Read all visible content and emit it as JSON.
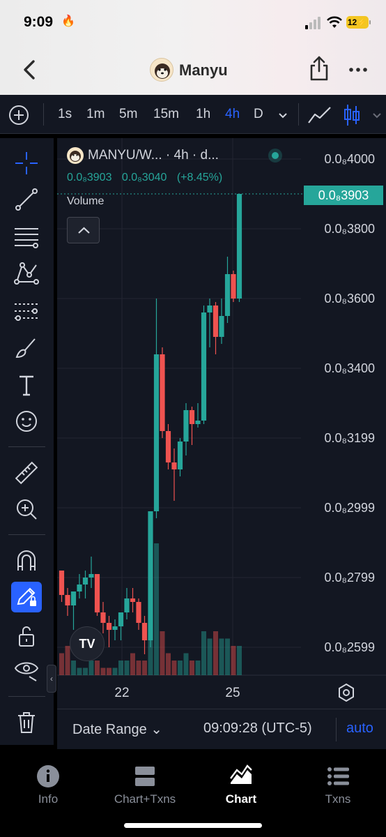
{
  "status_bar": {
    "time": "9:09",
    "battery": "12"
  },
  "header": {
    "title": "Manyu",
    "back_icon": "chevron-left-icon",
    "share_icon": "share-icon",
    "more_icon": "more-icon"
  },
  "toolbar": {
    "intervals": [
      "1s",
      "1m",
      "5m",
      "15m",
      "1h",
      "4h",
      "D"
    ],
    "active_interval": "4h"
  },
  "legend": {
    "symbol": "MANYU/W... · 4h · d...",
    "ohlc": [
      "0.0₈3903",
      "0.0₈3040",
      "(+8.45%)"
    ],
    "volume_label": "Volume"
  },
  "price_axis": {
    "labels": [
      "0.0₈4000",
      "0.0₈3800",
      "0.0₈3600",
      "0.0₈3400",
      "0.0₈3199",
      "0.0₈2999",
      "0.0₈2799",
      "0.0₈2599"
    ],
    "current_price_tag": "0.0₈3903"
  },
  "time_axis": {
    "labels": [
      "22",
      "25"
    ]
  },
  "chart_footer": {
    "date_range": "Date Range",
    "clock": "09:09:28 (UTC-5)",
    "auto": "auto"
  },
  "tabs": [
    {
      "label": "Info",
      "icon": "info-icon"
    },
    {
      "label": "Chart+Txns",
      "icon": "split-view-icon"
    },
    {
      "label": "Chart",
      "icon": "chart-icon"
    },
    {
      "label": "Txns",
      "icon": "list-icon"
    }
  ],
  "active_tab": "Chart",
  "colors": {
    "up": "#26a69a",
    "down": "#ef5350",
    "accent": "#2962ff",
    "background": "#131722"
  },
  "chart_data": {
    "type": "candlestick",
    "title": "",
    "y_unit": "× 1e-8",
    "ylim": [
      25.2,
      40.6
    ],
    "candles": [
      {
        "o": 28.2,
        "h": 28.2,
        "l": 27.3,
        "c": 27.5
      },
      {
        "o": 27.5,
        "h": 27.7,
        "l": 26.9,
        "c": 27.2
      },
      {
        "o": 27.2,
        "h": 27.6,
        "l": 26.5,
        "c": 27.6
      },
      {
        "o": 27.6,
        "h": 28.1,
        "l": 27.4,
        "c": 27.8
      },
      {
        "o": 27.8,
        "h": 28.2,
        "l": 27.4,
        "c": 28.0
      },
      {
        "o": 28.0,
        "h": 28.6,
        "l": 27.7,
        "c": 28.1
      },
      {
        "o": 28.1,
        "h": 28.1,
        "l": 26.9,
        "c": 27.0
      },
      {
        "o": 27.0,
        "h": 27.3,
        "l": 26.4,
        "c": 26.7
      },
      {
        "o": 26.7,
        "h": 26.9,
        "l": 26.0,
        "c": 26.5
      },
      {
        "o": 26.5,
        "h": 26.8,
        "l": 26.2,
        "c": 26.6
      },
      {
        "o": 26.6,
        "h": 27.0,
        "l": 26.2,
        "c": 27.0
      },
      {
        "o": 27.0,
        "h": 27.7,
        "l": 26.8,
        "c": 27.4
      },
      {
        "o": 27.4,
        "h": 27.7,
        "l": 27.0,
        "c": 27.3
      },
      {
        "o": 27.3,
        "h": 27.4,
        "l": 26.5,
        "c": 26.7
      },
      {
        "o": 26.7,
        "h": 26.9,
        "l": 25.8,
        "c": 26.2
      },
      {
        "o": 26.2,
        "h": 29.9,
        "l": 26.0,
        "c": 29.9
      },
      {
        "o": 29.9,
        "h": 36.0,
        "l": 29.7,
        "c": 34.4
      },
      {
        "o": 34.4,
        "h": 34.6,
        "l": 32.0,
        "c": 32.2
      },
      {
        "o": 32.2,
        "h": 32.4,
        "l": 31.1,
        "c": 31.3
      },
      {
        "o": 31.3,
        "h": 31.7,
        "l": 30.2,
        "c": 31.1
      },
      {
        "o": 31.1,
        "h": 32.0,
        "l": 30.9,
        "c": 31.9
      },
      {
        "o": 31.9,
        "h": 33.0,
        "l": 31.5,
        "c": 32.8
      },
      {
        "o": 32.8,
        "h": 32.9,
        "l": 31.8,
        "c": 32.4
      },
      {
        "o": 32.4,
        "h": 33.0,
        "l": 32.3,
        "c": 32.5
      },
      {
        "o": 32.5,
        "h": 35.8,
        "l": 32.4,
        "c": 35.6
      },
      {
        "o": 35.6,
        "h": 36.0,
        "l": 34.6,
        "c": 35.8
      },
      {
        "o": 35.8,
        "h": 35.9,
        "l": 34.4,
        "c": 34.9
      },
      {
        "o": 34.9,
        "h": 36.0,
        "l": 34.7,
        "c": 35.5
      },
      {
        "o": 35.5,
        "h": 37.2,
        "l": 35.3,
        "c": 36.7
      },
      {
        "o": 36.7,
        "h": 36.8,
        "l": 35.9,
        "c": 36.0
      },
      {
        "o": 36.0,
        "h": 39.0,
        "l": 35.9,
        "c": 39.0
      }
    ],
    "volume": [
      3,
      4,
      2,
      1,
      1,
      2,
      2,
      1,
      1,
      1,
      2,
      2,
      3,
      2,
      2,
      20,
      18,
      6,
      3,
      2,
      2,
      3,
      2,
      2,
      6,
      5,
      6,
      5,
      5,
      4,
      4
    ]
  }
}
